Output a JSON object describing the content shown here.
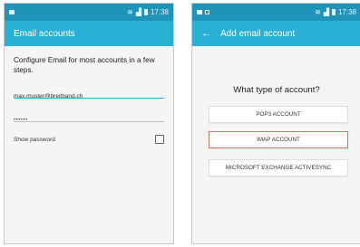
{
  "left_screen": {
    "status": {
      "time": "17:38"
    },
    "actionbar": {
      "title": "Email accounts"
    },
    "intro_text": "Configure Email for most accounts in a few steps.",
    "email_value": "max.muster@breitband.ch",
    "password_value": "••••••",
    "show_password_label": "Show password"
  },
  "right_screen": {
    "status": {
      "time": "17:38"
    },
    "actionbar": {
      "title": "Add email account"
    },
    "question": "What type of account?",
    "buttons": {
      "pop3": "POP3 ACCOUNT",
      "imap": "IMAP ACCOUNT",
      "exchange": "MICROSOFT EXCHANGE ACTIVESYNC"
    }
  },
  "colors": {
    "status_bar": "#1e94b8",
    "action_bar": "#29b0d5",
    "highlight": "#d9735f"
  },
  "icons": [
    "notification-icon",
    "wifi-icon",
    "signal-icon",
    "battery-icon",
    "back-arrow-icon"
  ]
}
